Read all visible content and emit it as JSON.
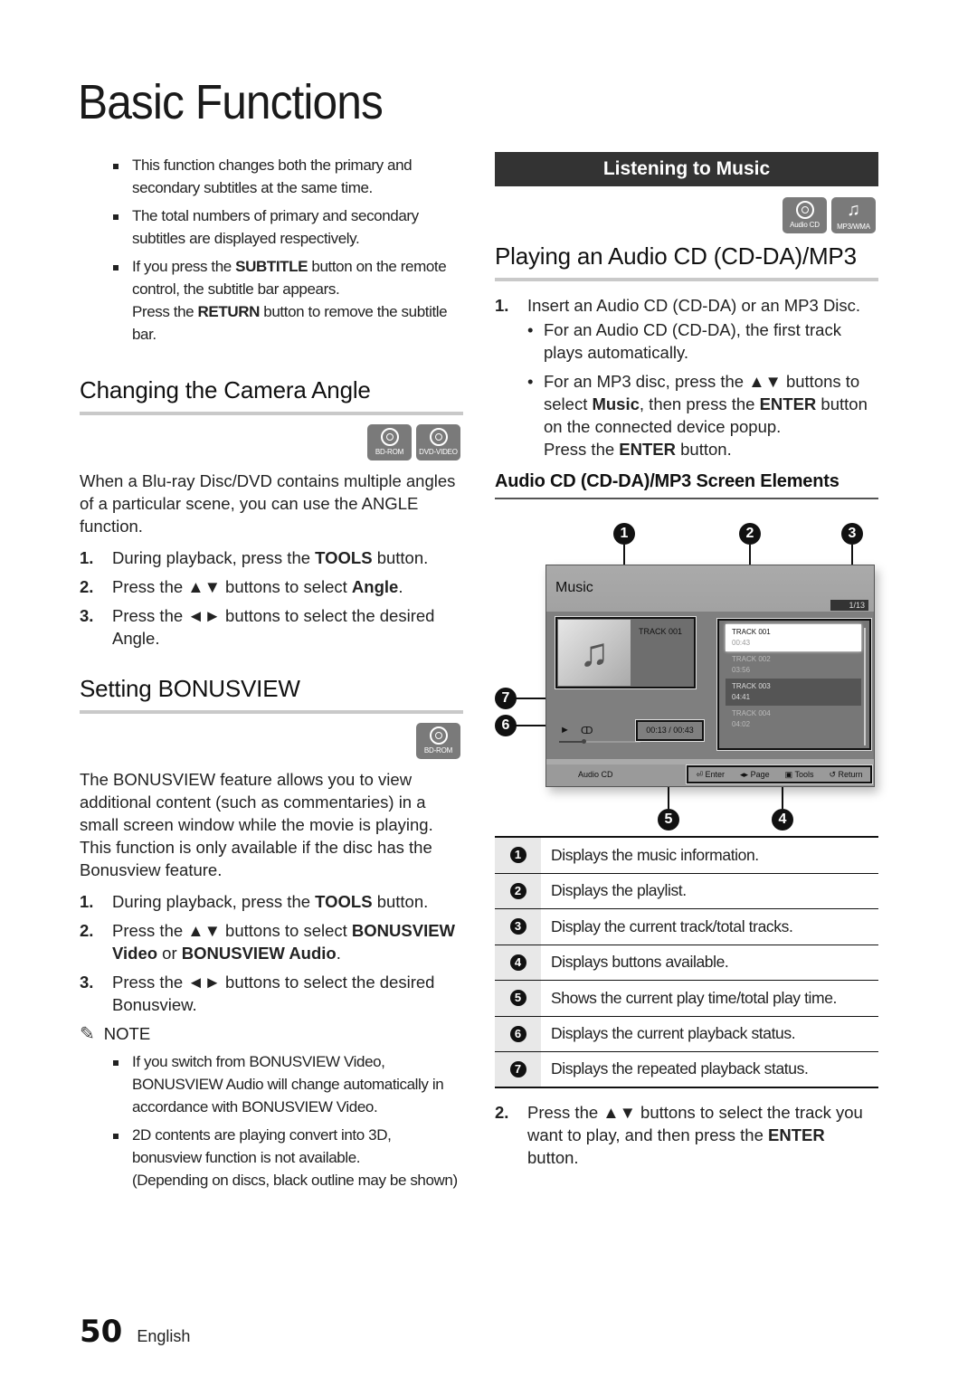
{
  "page": {
    "title": "Basic Functions",
    "page_number": "50",
    "language": "English"
  },
  "left": {
    "subtitle_notes": [
      {
        "text": "This function changes both the primary and secondary subtitles at the same time."
      },
      {
        "text": "The total numbers of primary and secondary subtitles are displayed respectively."
      },
      {
        "pre": "If you press the ",
        "bold": "SUBTITLE",
        "post": " button on the remote control, the subtitle bar appears.",
        "cont_pre": "Press the ",
        "cont_bold": "RETURN",
        "cont_post": " button to remove the subtitle bar."
      }
    ],
    "camera_angle": {
      "heading": "Changing the Camera Angle",
      "badges": [
        {
          "icon": "disc-icon",
          "label": "BD-ROM"
        },
        {
          "icon": "disc-icon",
          "label": "DVD-VIDEO"
        }
      ],
      "intro": "When a Blu-ray Disc/DVD contains multiple angles of a particular scene, you can use the ANGLE function.",
      "steps": [
        {
          "num": "1.",
          "pre": "During playback, press the ",
          "bold": "TOOLS",
          "post": " button."
        },
        {
          "num": "2.",
          "pre": "Press the ▲▼ buttons to select ",
          "bold": "Angle",
          "post": "."
        },
        {
          "num": "3.",
          "pre": "Press the ◄► buttons to select the desired Angle.",
          "bold": "",
          "post": ""
        }
      ]
    },
    "bonusview": {
      "heading": "Setting BONUSVIEW",
      "badges": [
        {
          "icon": "disc-icon",
          "label": "BD-ROM"
        }
      ],
      "intro": "The BONUSVIEW feature allows you to view additional content (such as commentaries) in a small screen window while the movie is playing. This function is only available if the disc has the Bonusview feature.",
      "steps": [
        {
          "num": "1.",
          "pre": "During playback, press the ",
          "bold": "TOOLS",
          "post": " button."
        },
        {
          "num": "2.",
          "pre": "Press the ▲▼ buttons to select ",
          "bold": "BONUSVIEW Video",
          "mid": " or ",
          "bold2": "BONUSVIEW Audio",
          "post": "."
        },
        {
          "num": "3.",
          "pre": "Press the ◄► buttons to select the desired Bonusview.",
          "bold": "",
          "post": ""
        }
      ],
      "note_label": "NOTE",
      "notes": [
        {
          "text": "If you switch from BONUSVIEW Video, BONUSVIEW Audio will change automatically in accordance with BONUSVIEW Video."
        },
        {
          "text": "2D contents are playing convert into 3D, bonusview function is not available.",
          "cont": "(Depending on discs, black outline may be shown)"
        }
      ]
    }
  },
  "right": {
    "banner": "Listening to Music",
    "badges": [
      {
        "icon": "disc-icon",
        "label": "Audio CD"
      },
      {
        "icon": "music-note-icon",
        "label": "MP3/WMA"
      }
    ],
    "heading": "Playing an Audio CD (CD-DA)/MP3",
    "step1": {
      "num": "1.",
      "text": "Insert an Audio CD (CD-DA) or an MP3 Disc."
    },
    "bullets": [
      {
        "text": "For an Audio CD (CD-DA), the first track plays automatically."
      },
      {
        "pre": "For an MP3 disc, press the ▲▼ buttons to select ",
        "bold": "Music",
        "mid": ", then press the ",
        "bold2": "ENTER",
        "post": " button on the connected device popup.",
        "cont_pre": "Press the ",
        "cont_bold": "ENTER",
        "cont_post": " button."
      }
    ],
    "subheading": "Audio CD (CD-DA)/MP3 Screen Elements",
    "screen": {
      "title": "Music",
      "track_count": "1/13",
      "now_playing": "TRACK 001",
      "play_symbol": "►",
      "repeat_symbol": "ↀ",
      "progress": 0.3,
      "time": "00:13 / 00:43",
      "source": "Audio CD",
      "playlist": [
        {
          "track": "TRACK 001",
          "time": "00:43",
          "state": "selected"
        },
        {
          "track": "TRACK 002",
          "time": "03:56",
          "state": "normal"
        },
        {
          "track": "TRACK 003",
          "time": "04:41",
          "state": "highlighted"
        },
        {
          "track": "TRACK 004",
          "time": "04:02",
          "state": "normal"
        }
      ],
      "buttons": [
        {
          "icon": "⏎",
          "label": "Enter"
        },
        {
          "icon": "◂▸",
          "label": "Page"
        },
        {
          "icon": "▣",
          "label": "Tools"
        },
        {
          "icon": "↺",
          "label": "Return"
        }
      ],
      "callouts": [
        "1",
        "2",
        "3",
        "4",
        "5",
        "6",
        "7"
      ]
    },
    "legend": [
      {
        "num": "1",
        "text": "Displays the music information."
      },
      {
        "num": "2",
        "text": "Displays the playlist."
      },
      {
        "num": "3",
        "text": "Display the current track/total tracks."
      },
      {
        "num": "4",
        "text": "Displays buttons available."
      },
      {
        "num": "5",
        "text": "Shows the current play time/total play time."
      },
      {
        "num": "6",
        "text": "Displays the current playback status."
      },
      {
        "num": "7",
        "text": "Displays the repeated playback status."
      }
    ],
    "step2": {
      "num": "2.",
      "pre": "Press the ▲▼ buttons to select the track you want to play, and then press the ",
      "bold": "ENTER",
      "post": " button."
    }
  }
}
